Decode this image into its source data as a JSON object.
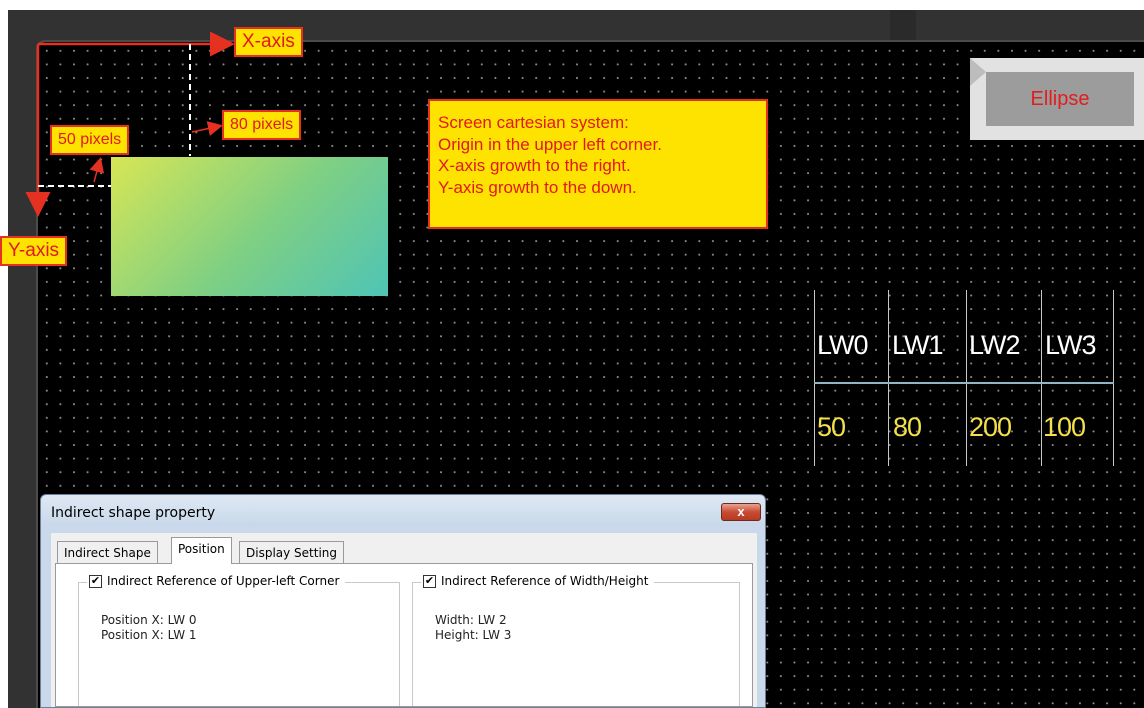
{
  "annotations": {
    "x_axis": "X-axis",
    "y_axis": "Y-axis",
    "y_offset": "50 pixels",
    "x_offset": "80 pixels",
    "note_lines": [
      "Screen cartesian system:",
      "Origin in the upper left corner.",
      "X-axis growth to the right.",
      "Y-axis growth to the down."
    ],
    "accent_color": "#e0191c",
    "box_color": "#ffe300"
  },
  "button": {
    "label": "Ellipse"
  },
  "lw_table": {
    "headers": [
      "LW0",
      "LW1",
      "LW2",
      "LW3"
    ],
    "values": [
      "50",
      "80",
      "200",
      "100"
    ]
  },
  "dialog": {
    "title": "Indirect shape property",
    "close_label": "x",
    "tabs": [
      "Indirect Shape",
      "Position",
      "Display Setting"
    ],
    "active_tab": "Position",
    "group_left": {
      "title": "Indirect Reference of Upper-left Corner",
      "checked": true,
      "lines": [
        "Position X: LW 0",
        "Position X: LW 1"
      ]
    },
    "group_right": {
      "title": "Indirect Reference of Width/Height",
      "checked": true,
      "lines": [
        "Width: LW 2",
        "Height: LW 3"
      ]
    }
  }
}
